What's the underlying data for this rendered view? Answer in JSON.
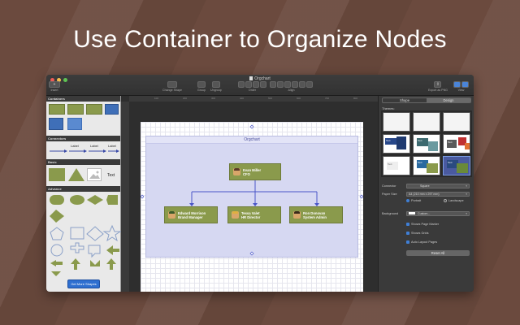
{
  "headline": "Use Container to Organize Nodes",
  "window": {
    "title": "Orgchart",
    "toolbar": {
      "insert": "Insert",
      "change_shape": "Change Shape",
      "group": "Group",
      "ungroup": "Ungroup",
      "order": "Order",
      "align": "Align",
      "export": "Export as PNG",
      "view": "View"
    }
  },
  "sidebar": {
    "sections": [
      "Containers",
      "Connectors",
      "Basic",
      "Advance"
    ],
    "connector_labels": [
      "Label",
      "Label",
      "Label"
    ],
    "basic_text": "Text",
    "get_more": "Get More Shapes"
  },
  "canvas": {
    "ruler_ticks": [
      "100",
      "200",
      "300",
      "400",
      "500",
      "600",
      "700",
      "800"
    ],
    "container_label": "Orgchart",
    "nodes": [
      {
        "name": "Evan Miller",
        "title": "CFO"
      },
      {
        "name": "Edward Morrison",
        "title": "Brand Manager"
      },
      {
        "name": "Tessa Valet",
        "title": "HR Director"
      },
      {
        "name": "Ron Donovan",
        "title": "System Admin"
      }
    ]
  },
  "inspector": {
    "tabs": [
      "Shape",
      "Design"
    ],
    "active_tab": "Design",
    "themes_label": "Themes:",
    "theme_sample_text": "Text",
    "connector_label": "Connector",
    "connector_value": "Square",
    "paper_size_label": "Paper Size",
    "paper_size_value": "A4 (210 mm x 297 mm)",
    "portrait": "Portrait",
    "landscape": "Landscape",
    "background_label": "Background",
    "background_value": "Custom...",
    "show_page_marker": "Shows Page Marker",
    "show_grids": "Shows Grids",
    "auto_layout_pages": "Auto Layout Pages",
    "reset": "Reset All"
  },
  "colors": {
    "background": "#6b4a3e",
    "node_fill": "#8a9a4c",
    "container_fill": "#d6d8f2",
    "connector_line": "#4a56c8",
    "accent_blue": "#3f7fd6"
  }
}
